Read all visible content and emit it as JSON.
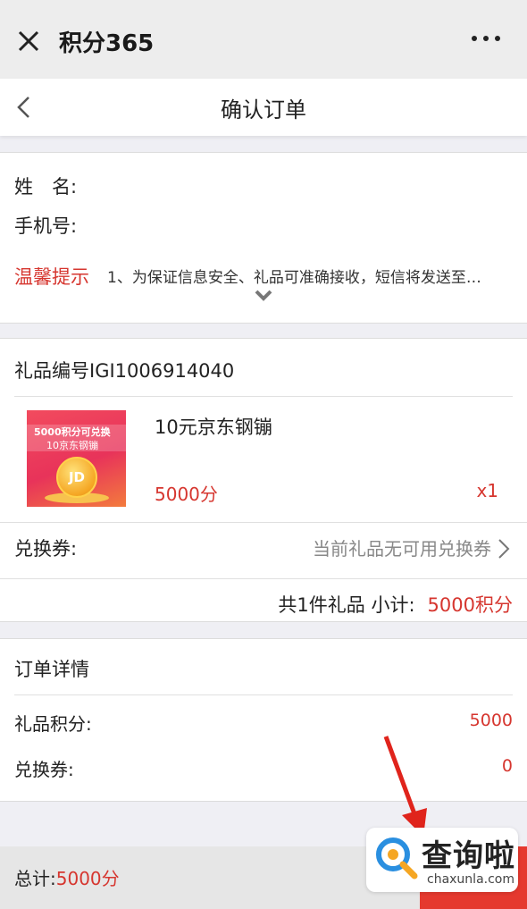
{
  "topbar": {
    "title": "积分365",
    "close_icon": "close-icon",
    "more_icon": "more-icon"
  },
  "navbar": {
    "title": "确认订单",
    "back_icon": "back-chevron-icon"
  },
  "contact": {
    "name_label": "姓　名:",
    "phone_label": "手机号:",
    "tip_label": "温馨提示",
    "tip_text": "1、为保证信息安全、礼品可准确接收，短信将发送至…"
  },
  "gift": {
    "number_label": "礼品编号IGI1006914040",
    "thumb_line1": "5000积分可兑换",
    "thumb_line2": "10京东钢镚",
    "thumb_coin": "JD",
    "name": "10元京东钢镚",
    "price": "5000分",
    "quantity": "x1",
    "coupon_label": "兑换券:",
    "coupon_value": "当前礼品无可用兑换券",
    "subtotal_label": "共1件礼品 小计:",
    "subtotal_value": "5000积分"
  },
  "details": {
    "title": "订单详情",
    "points_label": "礼品积分:",
    "points_value": "5000",
    "coupon_label": "兑换券:",
    "coupon_value": "0"
  },
  "footer": {
    "total_label": "总计:",
    "total_value": "5000分"
  },
  "watermark": {
    "text": "查询啦",
    "sub": "chaxunla.com"
  },
  "colors": {
    "accent": "#d6362f",
    "button": "#e5392f",
    "background": "#efeff4"
  }
}
